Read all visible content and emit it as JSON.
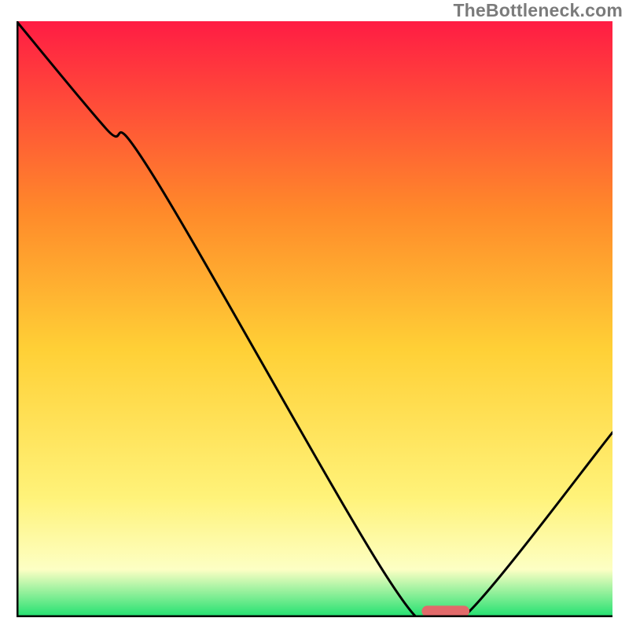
{
  "watermark": "TheBottleneck.com",
  "chart_data": {
    "type": "line",
    "title": "",
    "xlabel": "",
    "ylabel": "",
    "xlim": [
      0,
      100
    ],
    "ylim": [
      0,
      100
    ],
    "x": [
      0,
      15,
      23,
      62,
      70,
      76,
      100
    ],
    "values": [
      100,
      82,
      74,
      7,
      1,
      1,
      31
    ],
    "marker": {
      "x_start": 68,
      "x_end": 76,
      "y": 1
    },
    "annotations": [],
    "legend": []
  },
  "colors": {
    "gradient_top": "#ff1c44",
    "gradient_mid_upper": "#ff8a2a",
    "gradient_mid": "#ffd036",
    "gradient_mid_lower": "#fff37a",
    "gradient_lower": "#fdffc4",
    "gradient_bottom": "#1fe06f",
    "axis": "#000000",
    "curve": "#000000",
    "marker": "#e26a6a"
  }
}
